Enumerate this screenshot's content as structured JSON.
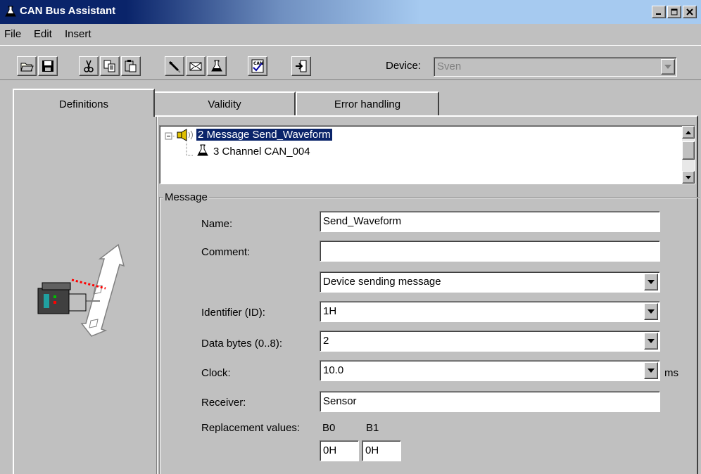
{
  "window": {
    "title": "CAN Bus Assistant"
  },
  "menu": {
    "items": [
      "File",
      "Edit",
      "Insert"
    ]
  },
  "toolbar": {
    "device_label": "Device:",
    "device_value": "Sven"
  },
  "tabs": [
    {
      "label": "Definitions"
    },
    {
      "label": "Validity"
    },
    {
      "label": "Error handling"
    }
  ],
  "tree": {
    "rows": [
      {
        "text": "2  Message  Send_Waveform",
        "selected": true
      },
      {
        "text": "3  Channel  CAN_004",
        "selected": false
      }
    ]
  },
  "message": {
    "group_title": "Message",
    "name_label": "Name:",
    "name_value": "Send_Waveform",
    "comment_label": "Comment:",
    "comment_value": "",
    "direction_value": "Device sending message",
    "identifier_label": "Identifier (ID):",
    "identifier_value": "1H",
    "databytes_label": "Data bytes (0..8):",
    "databytes_value": "2",
    "clock_label": "Clock:",
    "clock_value": "10.0",
    "clock_unit": "ms",
    "receiver_label": "Receiver:",
    "receiver_value": "Sensor",
    "replacement_label": "Replacement values:",
    "b0_label": "B0",
    "b1_label": "B1",
    "b0_value": "0H",
    "b1_value": "0H"
  }
}
